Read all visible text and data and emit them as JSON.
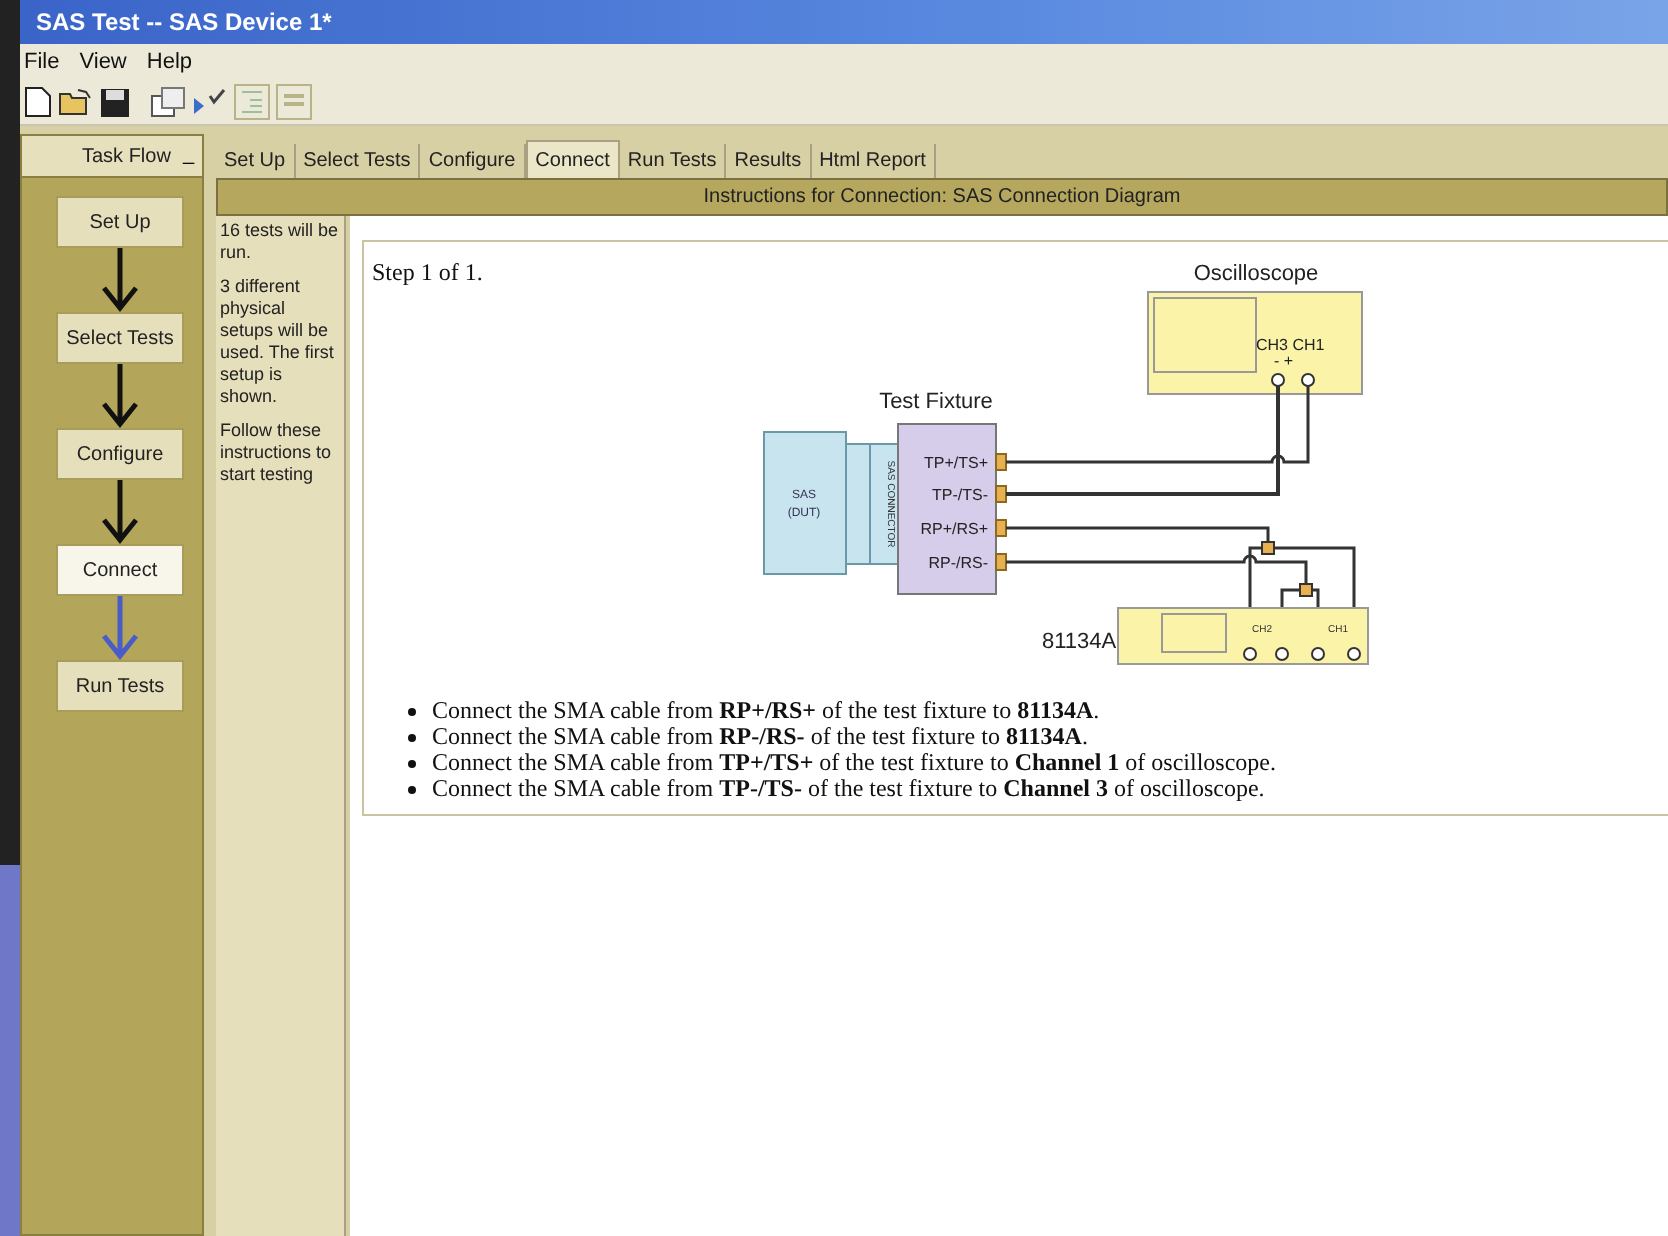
{
  "window": {
    "title": "SAS Test -- SAS Device 1*"
  },
  "menu": [
    "File",
    "View",
    "Help"
  ],
  "task_flow": {
    "title": "Task Flow",
    "collapse": "_",
    "steps": [
      {
        "label": "Set Up",
        "selected": false
      },
      {
        "label": "Select Tests",
        "selected": false
      },
      {
        "label": "Configure",
        "selected": false
      },
      {
        "label": "Connect",
        "selected": true
      },
      {
        "label": "Run Tests",
        "selected": false
      }
    ]
  },
  "tabs": [
    {
      "label": "Set Up",
      "selected": false
    },
    {
      "label": "Select Tests",
      "selected": false
    },
    {
      "label": "Configure",
      "selected": false
    },
    {
      "label": "Connect",
      "selected": true
    },
    {
      "label": "Run Tests",
      "selected": false
    },
    {
      "label": "Results",
      "selected": false
    },
    {
      "label": "Html Report",
      "selected": false
    }
  ],
  "header": "Instructions for Connection: SAS Connection Diagram",
  "info": [
    "16 tests will be run.",
    "3 different physical setups will be used. The first setup is shown.",
    "Follow these instructions to start testing"
  ],
  "step": "Step 1 of 1.",
  "diagram": {
    "oscilloscope": "Oscilloscope",
    "scope_channels": "CH3 CH1",
    "scope_polarity": "-   +",
    "fixture": "Test Fixture",
    "ports": [
      "TP+/TS+",
      "TP-/TS-",
      "RP+/RS+",
      "RP-/RS-"
    ],
    "dut": [
      "SAS",
      "(DUT)"
    ],
    "connector": "SAS CONNECTOR",
    "generator": "81134A",
    "gen_ch2": "CH2",
    "gen_ch1": "CH1"
  },
  "instructions": [
    "Connect the SMA cable from **RP+/RS+** of the test fixture to **81134A**.",
    "Connect the SMA cable from **RP-/RS-** of the test fixture to **81134A**.",
    "Connect the SMA cable from **TP+/TS+** of the test fixture to **Channel 1** of oscilloscope.",
    "Connect the SMA cable from **TP-/TS-** of the test fixture to **Channel 3** of oscilloscope."
  ]
}
